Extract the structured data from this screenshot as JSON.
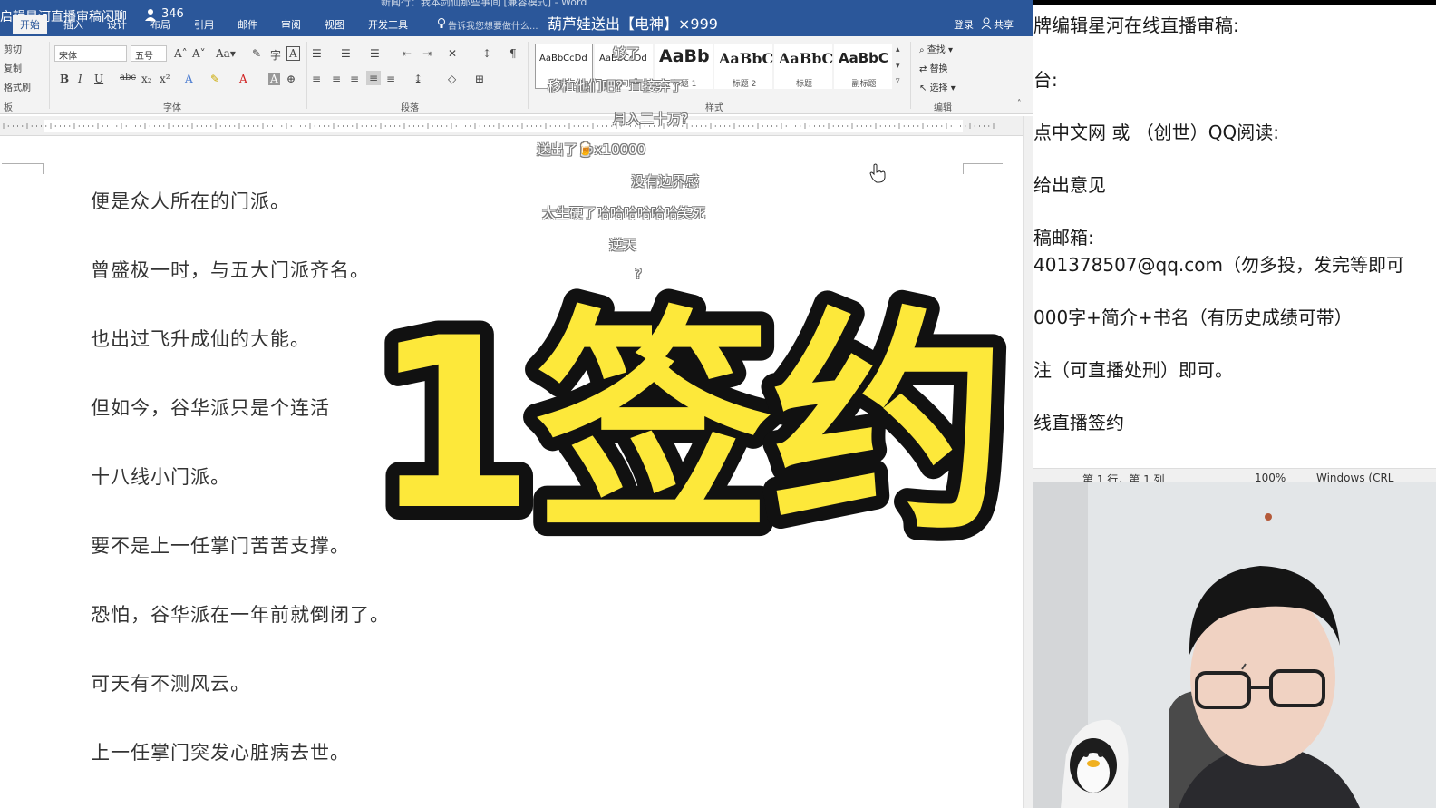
{
  "titlebar": {
    "stream_title": "启辑星河直播审稿闲聊",
    "viewer_count": "346",
    "doc_title": "新闻行：我本剑仙那些事间 [兼容模式] - Word",
    "tellme": "告诉我您想要做什么...",
    "login": "登录",
    "share": "共享",
    "tabs": [
      "开始",
      "插入",
      "设计",
      "布局",
      "引用",
      "邮件",
      "审阅",
      "视图",
      "开发工具"
    ]
  },
  "ribbon": {
    "clipboard": [
      "剪切",
      "复制",
      "格式刷"
    ],
    "clipboard_label": "板",
    "font_name": "宋体",
    "font_size": "五号",
    "font_label": "字体",
    "paragraph_label": "段落",
    "styles_label": "样式",
    "editing_label": "编辑",
    "styles": [
      {
        "sample": "AaBbCcDd",
        "name": "正文"
      },
      {
        "sample": "AaBbCcDd",
        "name": "无间隔"
      },
      {
        "sample": "AaBb",
        "name": "标题 1"
      },
      {
        "sample": "AaBbC",
        "name": "标题 2"
      },
      {
        "sample": "AaBbC",
        "name": "标题"
      },
      {
        "sample": "AaBbC",
        "name": "副标题"
      }
    ],
    "editing": [
      "查找",
      "替换",
      "选择"
    ]
  },
  "document": {
    "lines": [
      "便是众人所在的门派。",
      "曾盛极一时，与五大门派齐名。",
      "也出过飞升成仙的大能。",
      "但如今，谷华派只是个连活",
      "十八线小门派。",
      "要不是上一任掌门苦苦支撑。",
      "恐怕，谷华派在一年前就倒闭了。",
      "可天有不测风云。",
      "上一任掌门突发心脏病去世。"
    ]
  },
  "danmaku": {
    "gift_message": "葫芦娃送出【电神】×999",
    "comments": [
      "够了",
      "移植他们吧？直接弃了",
      "月入二十万?",
      "送出了🍺x10000",
      "没有边界感",
      "太生硬了哈哈哈哈哈哈笑死",
      "逆天",
      "?"
    ]
  },
  "overlay": {
    "big_text": "1签约",
    "fill": "#fde83a",
    "stroke": "#111111"
  },
  "notepad": {
    "lines": [
      "牌编辑星河在线直播审稿:",
      "台:",
      "点中文网 或 （创世）QQ阅读:",
      "给出意见",
      "稿邮箱:",
      "401378507@qq.com（勿多投，发完等即可",
      "000字+简介+书名（有历史成绩可带）",
      "注（可直播处刑）即可。",
      "线直播签约"
    ],
    "status": [
      "第 1 行，第 1 列",
      "100%",
      "Windows (CRL"
    ]
  },
  "colors": {
    "word_blue": "#2b579a",
    "ribbon_bg": "#f3f3f3",
    "doc_text": "#333333"
  }
}
